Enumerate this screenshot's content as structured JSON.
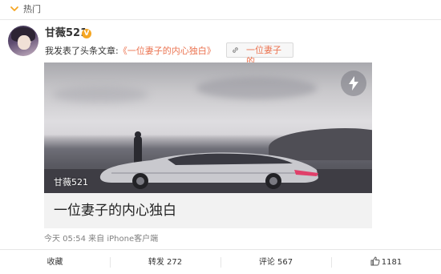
{
  "hot": {
    "label": "热门",
    "icon": "chevron-down-icon"
  },
  "author": {
    "name": "甘薇521",
    "badge_icon": "vip-badge-icon"
  },
  "post": {
    "prefix": "我发表了头条文章:",
    "article_link": "《一位妻子的内心独白》",
    "tag_button": "一位妻子的..."
  },
  "card": {
    "image_author": "甘薇521",
    "title": "一位妻子的内心独白",
    "badge_icon": "lightning-icon"
  },
  "meta": {
    "text": "今天 05:54 来自 iPhone客户端"
  },
  "actions": {
    "collect": "收藏",
    "repost": "转发 272",
    "comment": "评论 567",
    "like": "1181"
  },
  "colors": {
    "link": "#eb7350",
    "vip": "#f5a623"
  }
}
